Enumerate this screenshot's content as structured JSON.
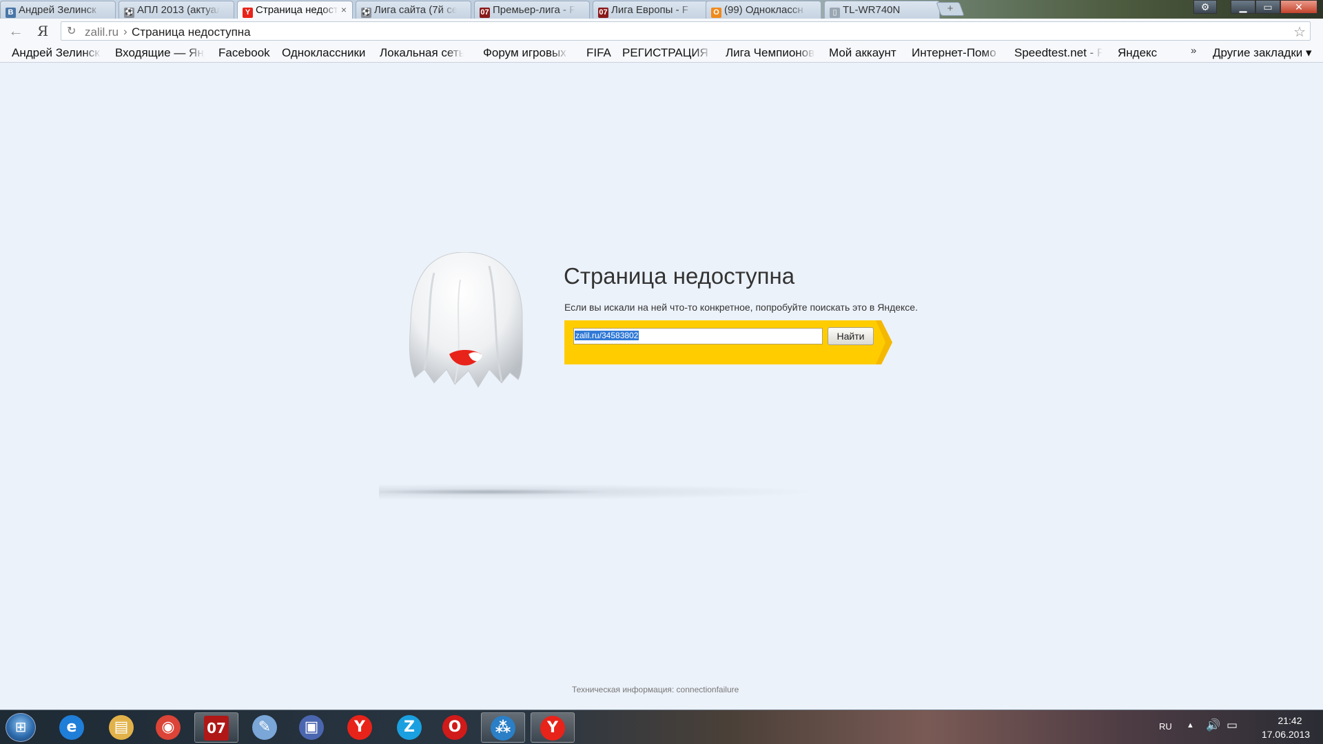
{
  "tabs": [
    {
      "title": "Андрей Зелинск",
      "favicon": "vk-icon",
      "favicon_glyph": "В",
      "favicon_color": "#4a76a8",
      "active": false
    },
    {
      "title": "АПЛ 2013 (актуал",
      "favicon": "league-icon",
      "favicon_glyph": "⚽",
      "favicon_color": "#8a8f99",
      "active": false
    },
    {
      "title": "Страница недост",
      "favicon": "yandex-icon",
      "favicon_glyph": "Y",
      "favicon_color": "#e8231a",
      "active": true,
      "close": "×"
    },
    {
      "title": "Лига сайта (7й се",
      "favicon": "league-icon",
      "favicon_glyph": "⚽",
      "favicon_color": "#8a8f99",
      "active": false
    },
    {
      "title": "Премьер-лига - F",
      "favicon": "football-site-icon",
      "favicon_glyph": "07",
      "favicon_color": "#8b1a1a",
      "active": false
    },
    {
      "title": "Лига Европы - F",
      "favicon": "football-site-icon",
      "favicon_glyph": "07",
      "favicon_color": "#8b1a1a",
      "active": false
    },
    {
      "title": "(99) Одноклассн",
      "favicon": "odnoklassniki-icon",
      "favicon_glyph": "О",
      "favicon_color": "#f08a1c",
      "active": false
    },
    {
      "title": "TL-WR740N",
      "favicon": "page-icon",
      "favicon_glyph": "▯",
      "favicon_color": "#9aa6b2",
      "active": false
    }
  ],
  "window": {
    "new_tab": "+",
    "settings": "⚙",
    "minimize": "▁",
    "maximize": "▭",
    "close": "✕"
  },
  "toolbar": {
    "back": "←",
    "yandex_button": "Я",
    "reload": "↻",
    "url_host": "zalil.ru",
    "url_sep": "›",
    "url_title": "Страница недоступна",
    "star": "☆"
  },
  "bookmarks": {
    "items": [
      "Андрей Зелинск",
      "Входящие — Янд",
      "Facebook",
      "Одноклассники",
      "Локальная сеть",
      "Форум игровых",
      "FIFA",
      "РЕГИСТРАЦИЯ (",
      "Лига Чемпионов",
      "Мой аккаунт",
      "Интернет-Помо",
      "Speedtest.net - F",
      "Яндекс"
    ],
    "more": "»",
    "other": "Другие закладки ▾"
  },
  "error_page": {
    "title": "Страница недоступна",
    "description": "Если вы искали на ней что-то конкретное, попробуйте поискать это в Яндексе.",
    "search_value": "zalil.ru/34583802",
    "search_button": "Найти",
    "tech_info": "Техническая информация: connectionfailure",
    "accent_color": "#ffcc00"
  },
  "taskbar": {
    "start": "⊞",
    "items": [
      {
        "name": "ie-icon",
        "glyph": "e",
        "color": "#1f7ed8"
      },
      {
        "name": "explorer-icon",
        "glyph": "▤",
        "color": "#e2b24a"
      },
      {
        "name": "chrome-icon",
        "glyph": "◉",
        "color": "#db4437"
      },
      {
        "name": "app-07-icon",
        "glyph": "07",
        "color": "#b01818"
      },
      {
        "name": "paint-icon",
        "glyph": "✎",
        "color": "#7aa6d8"
      },
      {
        "name": "network-app-icon",
        "glyph": "▣",
        "color": "#4b66b0"
      },
      {
        "name": "yandex-browser-icon",
        "glyph": "Y",
        "color": "#e8231a"
      },
      {
        "name": "zona-icon",
        "glyph": "Z",
        "color": "#1aa0e0"
      },
      {
        "name": "opera-icon",
        "glyph": "O",
        "color": "#d11a1a"
      },
      {
        "name": "utorrent-icon",
        "glyph": "⁂",
        "color": "#2a7fc6"
      },
      {
        "name": "yandex-browser-icon",
        "glyph": "Y",
        "color": "#e8231a"
      }
    ],
    "tray": {
      "lang": "RU",
      "arrow": "▲",
      "volume": "🔊",
      "network": "▭",
      "time": "21:42",
      "date": "17.06.2013"
    }
  }
}
